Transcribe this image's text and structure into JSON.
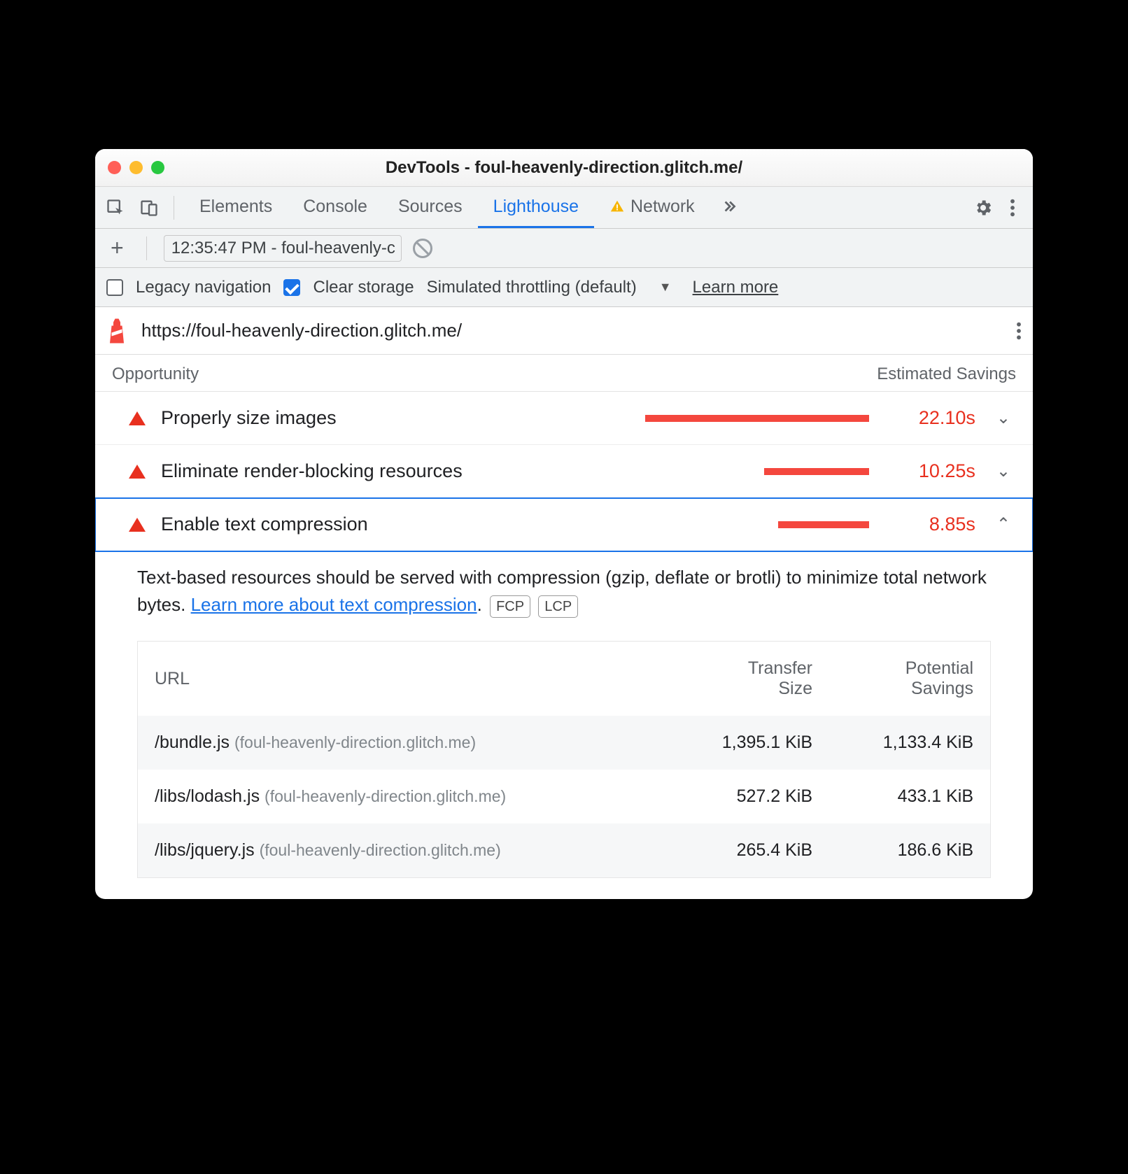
{
  "title": "DevTools - foul-heavenly-direction.glitch.me/",
  "tabs": {
    "elements": "Elements",
    "console": "Console",
    "sources": "Sources",
    "lighthouse": "Lighthouse",
    "network": "Network"
  },
  "subbar": {
    "run_label": "12:35:47 PM - foul-heavenly-c"
  },
  "options": {
    "legacy_nav": "Legacy navigation",
    "clear_storage": "Clear storage",
    "throttling": "Simulated throttling (default)",
    "learn_more": "Learn more"
  },
  "url": "https://foul-heavenly-direction.glitch.me/",
  "section": {
    "opportunity": "Opportunity",
    "est_savings": "Estimated Savings"
  },
  "opps": [
    {
      "label": "Properly size images",
      "savings": "22.10s",
      "bar": 320,
      "open": false
    },
    {
      "label": "Eliminate render-blocking resources",
      "savings": "10.25s",
      "bar": 150,
      "open": false
    },
    {
      "label": "Enable text compression",
      "savings": "8.85s",
      "bar": 130,
      "open": true
    }
  ],
  "detail": {
    "text_a": "Text-based resources should be served with compression (gzip, deflate or brotli) to minimize total network bytes. ",
    "link": "Learn more about text compression",
    "period": ".",
    "badge1": "FCP",
    "badge2": "LCP",
    "headers": {
      "url": "URL",
      "size_l1": "Transfer",
      "size_l2": "Size",
      "save_l1": "Potential",
      "save_l2": "Savings"
    },
    "rows": [
      {
        "path": "/bundle.js",
        "host": "(foul-heavenly-direction.glitch.me)",
        "size": "1,395.1 KiB",
        "save": "1,133.4 KiB"
      },
      {
        "path": "/libs/lodash.js",
        "host": "(foul-heavenly-direction.glitch.me)",
        "size": "527.2 KiB",
        "save": "433.1 KiB"
      },
      {
        "path": "/libs/jquery.js",
        "host": "(foul-heavenly-direction.glitch.me)",
        "size": "265.4 KiB",
        "save": "186.6 KiB"
      }
    ]
  }
}
